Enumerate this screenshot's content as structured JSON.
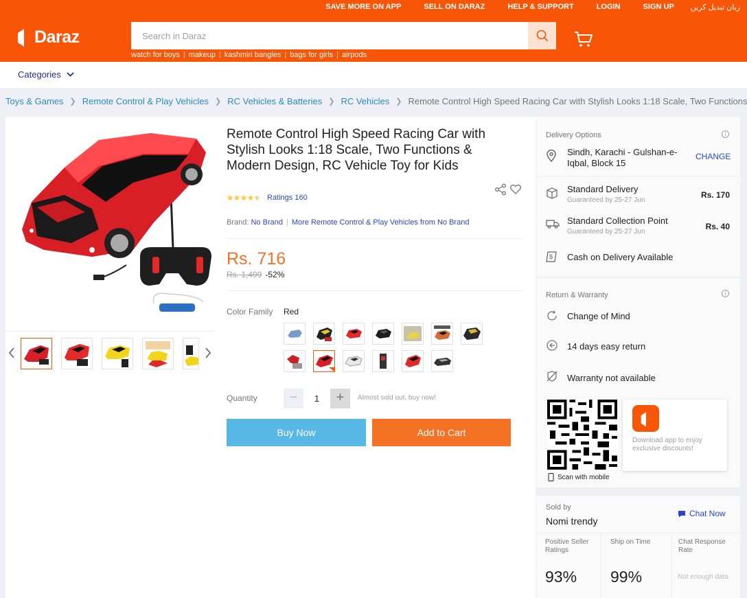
{
  "header": {
    "links": [
      "SAVE MORE ON APP",
      "SELL ON DARAZ",
      "HELP & SUPPORT",
      "LOGIN",
      "SIGN UP",
      "زبان تبدیل کریں"
    ],
    "logo_text": "Daraz",
    "search_placeholder": "Search in Daraz",
    "suggestions": [
      "watch for boys",
      "makeup",
      "kashmiri bangles",
      "bags for girls",
      "airpods"
    ],
    "brand_color": "#f85606"
  },
  "nav": {
    "categories_label": "Categories"
  },
  "breadcrumb": {
    "items": [
      "Toys & Games",
      "Remote Control & Play Vehicles",
      "RC Vehicles & Batteries",
      "RC Vehicles"
    ],
    "current": "Remote Control High Speed Racing Car with Stylish Looks 1:18 Scale, Two Functions &"
  },
  "product": {
    "title": "Remote Control High Speed Racing Car with Stylish Looks 1:18 Scale, Two Functions & Modern Design, RC Vehicle Toy for Kids",
    "rating_value": 4.5,
    "ratings_label": "Ratings 160",
    "brand_label": "Brand:",
    "brand_name": "No Brand",
    "more_link": "More Remote Control & Play Vehicles from No Brand",
    "price": "Rs. 716",
    "original_price": "Rs. 1,499",
    "discount": "-52%",
    "color_label": "Color Family",
    "color_value": "Red",
    "quantity_label": "Quantity",
    "quantity": "1",
    "quantity_note": "Almost sold out, buy now!",
    "buy_now": "Buy Now",
    "add_to_cart": "Add to Cart",
    "price_color": "#f57224"
  },
  "delivery": {
    "title": "Delivery Options",
    "location": "Sindh, Karachi - Gulshan-e-Iqbal, Block 15",
    "change": "CHANGE",
    "options": [
      {
        "name": "Standard Delivery",
        "sub": "Guaranteed by 25-27 Jun",
        "price": "Rs. 170"
      },
      {
        "name": "Standard Collection Point",
        "sub": "Guaranteed by 25-27 Jun",
        "price": "Rs. 40"
      }
    ],
    "cod": "Cash on Delivery Available"
  },
  "warranty": {
    "title": "Return & Warranty",
    "items": [
      "Change of Mind",
      "14 days easy return",
      "Warranty not available"
    ]
  },
  "app_promo": {
    "scan_text": "Scan with mobile",
    "text": "Download app to enjoy exclusive discounts!"
  },
  "seller": {
    "sold_by_label": "Sold by",
    "name": "Nomi trendy",
    "chat": "Chat Now",
    "stats": [
      {
        "label": "Positive Seller Ratings",
        "value": "93%"
      },
      {
        "label": "Ship on Time",
        "value": "99%"
      },
      {
        "label": "Chat Response Rate",
        "value": "Not enough data"
      }
    ]
  }
}
